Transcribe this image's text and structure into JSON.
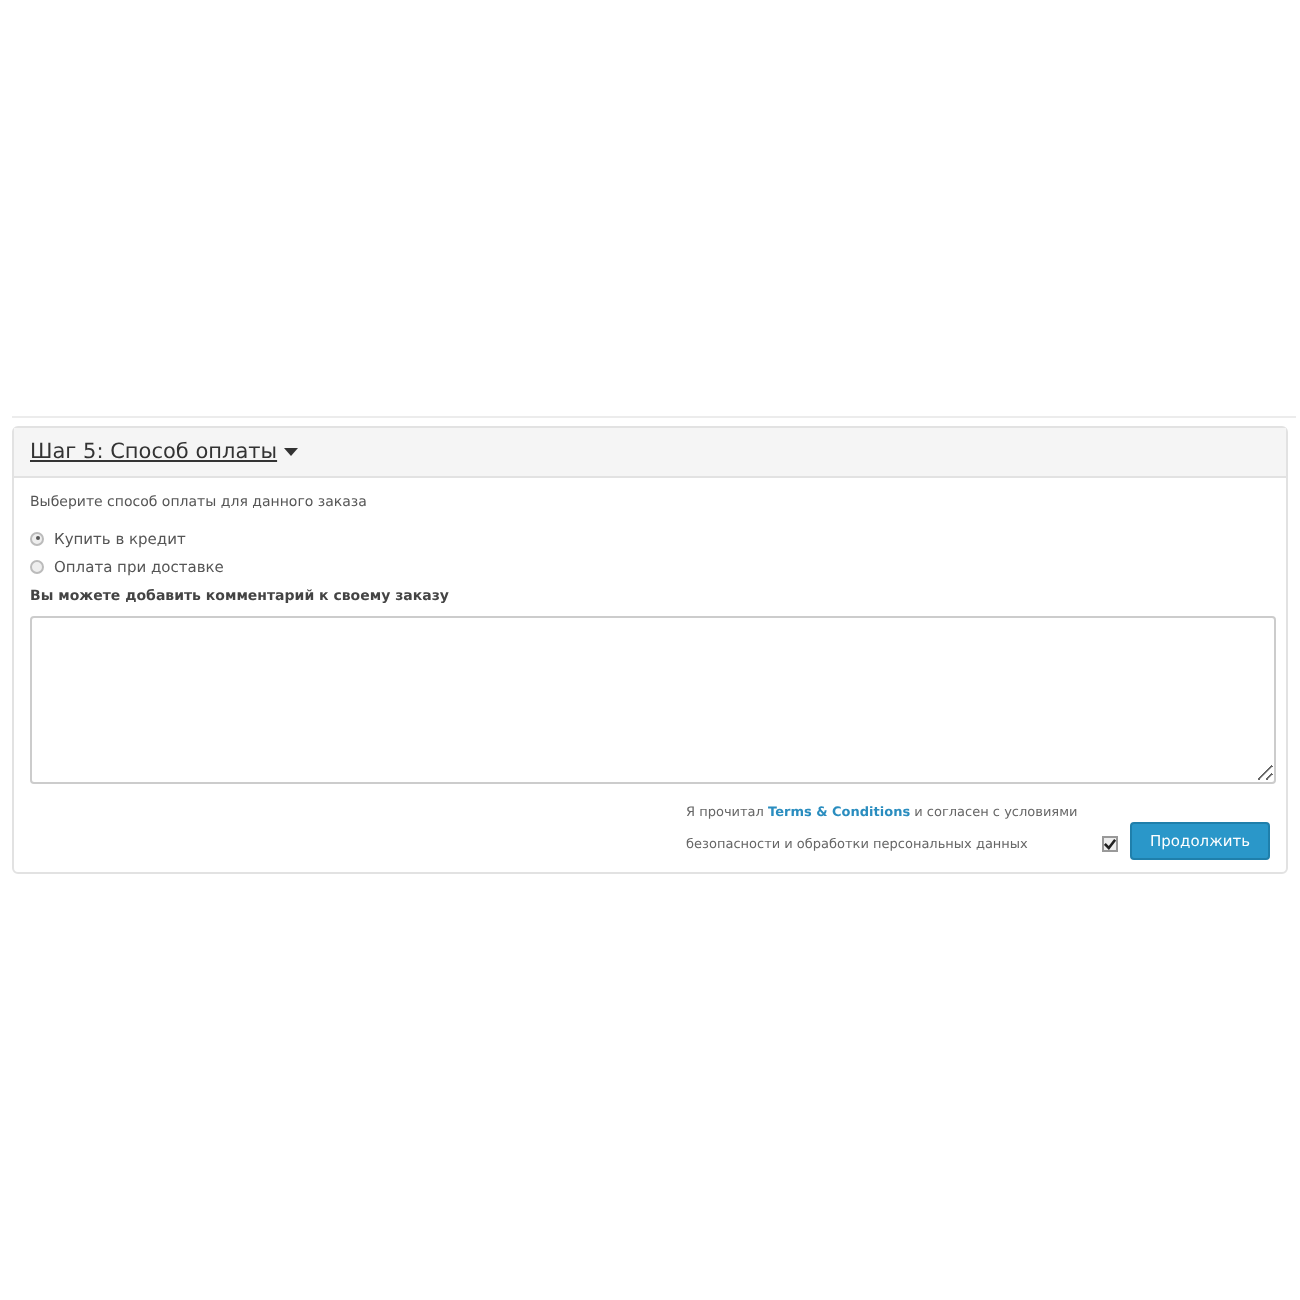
{
  "panel": {
    "title": "Шаг 5: Способ оплаты",
    "expanded": true
  },
  "payment": {
    "prompt": "Выберите способ оплаты для данного заказа",
    "options": [
      {
        "label": "Купить в кредит",
        "selected": true
      },
      {
        "label": "Оплата при доставке",
        "selected": false
      }
    ]
  },
  "comment": {
    "label": "Вы можете добавить комментарий к своему заказу"
  },
  "agreement": {
    "before": "Я прочитал",
    "link": "Terms & Conditions",
    "after": "и согласен с условиями безопасности и обработки персональных данных",
    "checked": true
  },
  "button": "Продолжить"
}
